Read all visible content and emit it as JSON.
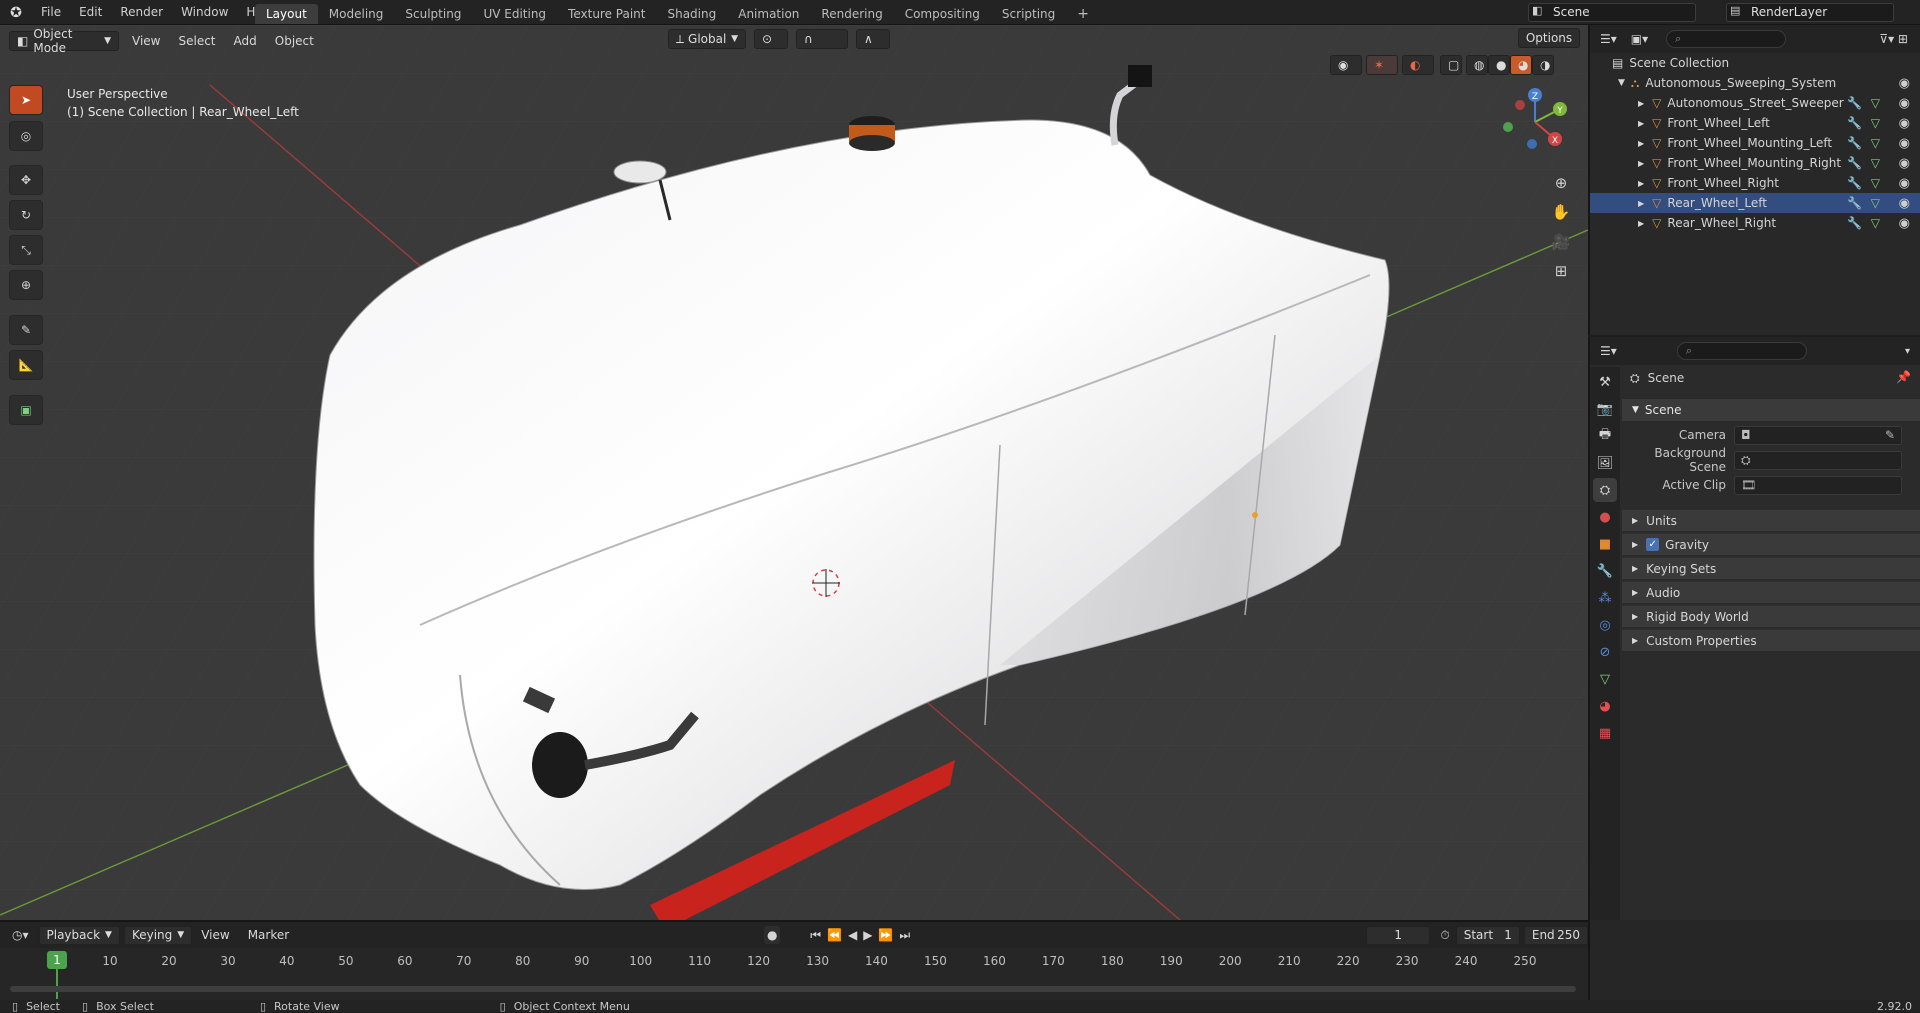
{
  "topbar": {
    "menus": [
      "File",
      "Edit",
      "Render",
      "Window",
      "Help"
    ],
    "workspaces": [
      "Layout",
      "Modeling",
      "Sculpting",
      "UV Editing",
      "Texture Paint",
      "Shading",
      "Animation",
      "Rendering",
      "Compositing",
      "Scripting"
    ],
    "active_workspace": "Layout",
    "add_tab": "+",
    "scene_name": "Scene",
    "view_layer": "RenderLayer"
  },
  "viewport": {
    "mode": "Object Mode",
    "menus": [
      "View",
      "Select",
      "Add",
      "Object"
    ],
    "orientation": "Global",
    "options_label": "Options",
    "overlay_line1": "User Perspective",
    "overlay_line2": "(1) Scene Collection | Rear_Wheel_Left",
    "gizmo_axes": {
      "x": "X",
      "y": "Y",
      "z": "Z"
    }
  },
  "tools": [
    "select-box",
    "cursor",
    "move",
    "rotate",
    "scale",
    "transform",
    "annotate",
    "measure",
    "add-cube"
  ],
  "outliner": {
    "root": "Scene Collection",
    "collection": "Autonomous_Sweeping_System",
    "objects": [
      {
        "name": "Autonomous_Street_Sweeper",
        "selected": false
      },
      {
        "name": "Front_Wheel_Left",
        "selected": false
      },
      {
        "name": "Front_Wheel_Mounting_Left",
        "selected": false
      },
      {
        "name": "Front_Wheel_Mounting_Right",
        "selected": false
      },
      {
        "name": "Front_Wheel_Right",
        "selected": false
      },
      {
        "name": "Rear_Wheel_Left",
        "selected": true
      },
      {
        "name": "Rear_Wheel_Right",
        "selected": false
      }
    ]
  },
  "properties": {
    "context": "Scene",
    "panel": "Scene",
    "fields": [
      {
        "label": "Camera",
        "value": ""
      },
      {
        "label": "Background Scene",
        "value": ""
      },
      {
        "label": "Active Clip",
        "value": ""
      }
    ],
    "subpanels": [
      "Units",
      "Gravity",
      "Keying Sets",
      "Audio",
      "Rigid Body World",
      "Custom Properties"
    ],
    "gravity_checked": true
  },
  "timeline": {
    "menus": [
      "Playback",
      "Keying",
      "View",
      "Marker"
    ],
    "current_frame": "1",
    "start_label": "Start",
    "start": "1",
    "end_label": "End",
    "end": "250",
    "ruler": [
      "1",
      "10",
      "20",
      "30",
      "40",
      "50",
      "60",
      "70",
      "80",
      "90",
      "100",
      "110",
      "120",
      "130",
      "140",
      "150",
      "160",
      "170",
      "180",
      "190",
      "200",
      "210",
      "220",
      "230",
      "240",
      "250"
    ]
  },
  "statusbar": {
    "select": "Select",
    "box_select": "Box Select",
    "rotate_view": "Rotate View",
    "context_menu": "Object Context Menu",
    "version": "2.92.0"
  },
  "colors": {
    "accent": "#4772b3",
    "active_tool": "#c14a23",
    "selection": "#334d80"
  }
}
